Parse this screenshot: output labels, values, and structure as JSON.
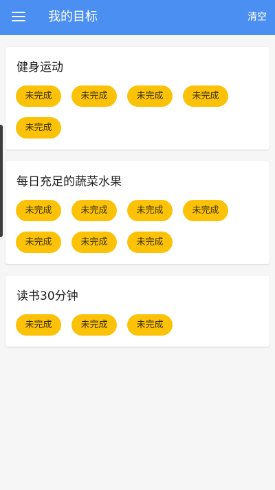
{
  "app_bar": {
    "title": "我的目标",
    "clear_label": "清空",
    "background": "#4a8ff1",
    "menu_icon": "menu-icon"
  },
  "chip_color": "#fcc207",
  "goals": [
    {
      "title": "健身运动",
      "chips": [
        "未完成",
        "未完成",
        "未完成",
        "未完成",
        "未完成"
      ]
    },
    {
      "title": "每日充足的蔬菜水果",
      "chips": [
        "未完成",
        "未完成",
        "未完成",
        "未完成",
        "未完成",
        "未完成",
        "未完成"
      ]
    },
    {
      "title": "读书30分钟",
      "chips": [
        "未完成",
        "未完成",
        "未完成"
      ]
    }
  ]
}
